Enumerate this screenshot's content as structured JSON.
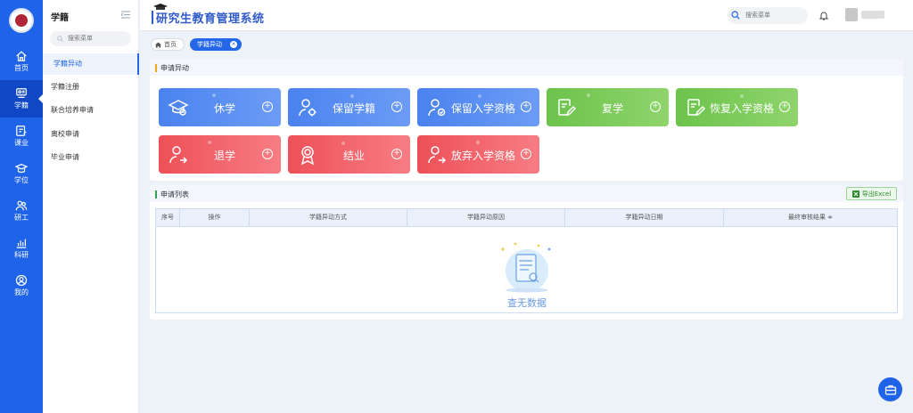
{
  "app": {
    "title": "研究生教育管理系统"
  },
  "rail": {
    "items": [
      {
        "label": "首页"
      },
      {
        "label": "学籍"
      },
      {
        "label": "课业"
      },
      {
        "label": "学位"
      },
      {
        "label": "研工"
      },
      {
        "label": "科研"
      },
      {
        "label": "我的"
      }
    ]
  },
  "menu": {
    "title": "学籍",
    "search_placeholder": "搜索菜单",
    "items": [
      {
        "label": "学籍异动"
      },
      {
        "label": "学籍注册"
      },
      {
        "label": "联合培养申请"
      },
      {
        "label": "离校申请"
      },
      {
        "label": "毕业申请"
      }
    ]
  },
  "topbar": {
    "search_placeholder": "搜索菜单"
  },
  "tabs": {
    "home": "首页",
    "active": "学籍异动"
  },
  "apply": {
    "title": "申请异动",
    "buttons": [
      {
        "label": "休学",
        "color": "#4a82ef"
      },
      {
        "label": "保留学籍",
        "color": "#4a82ef"
      },
      {
        "label": "保留入学资格",
        "color": "#4a82ef"
      },
      {
        "label": "复学",
        "color": "#6cc34c"
      },
      {
        "label": "恢复入学资格",
        "color": "#6cc34c"
      },
      {
        "label": "退学",
        "color": "#ee5058"
      },
      {
        "label": "结业",
        "color": "#ee5058"
      },
      {
        "label": "放弃入学资格",
        "color": "#ee5058"
      }
    ]
  },
  "list": {
    "title": "申请列表",
    "export_label": "导出Excel",
    "columns": [
      "序号",
      "操作",
      "学籍异动方式",
      "学籍异动原因",
      "学籍异动日期",
      "最终审核结果 ≑"
    ],
    "empty_text": "查无数据"
  }
}
